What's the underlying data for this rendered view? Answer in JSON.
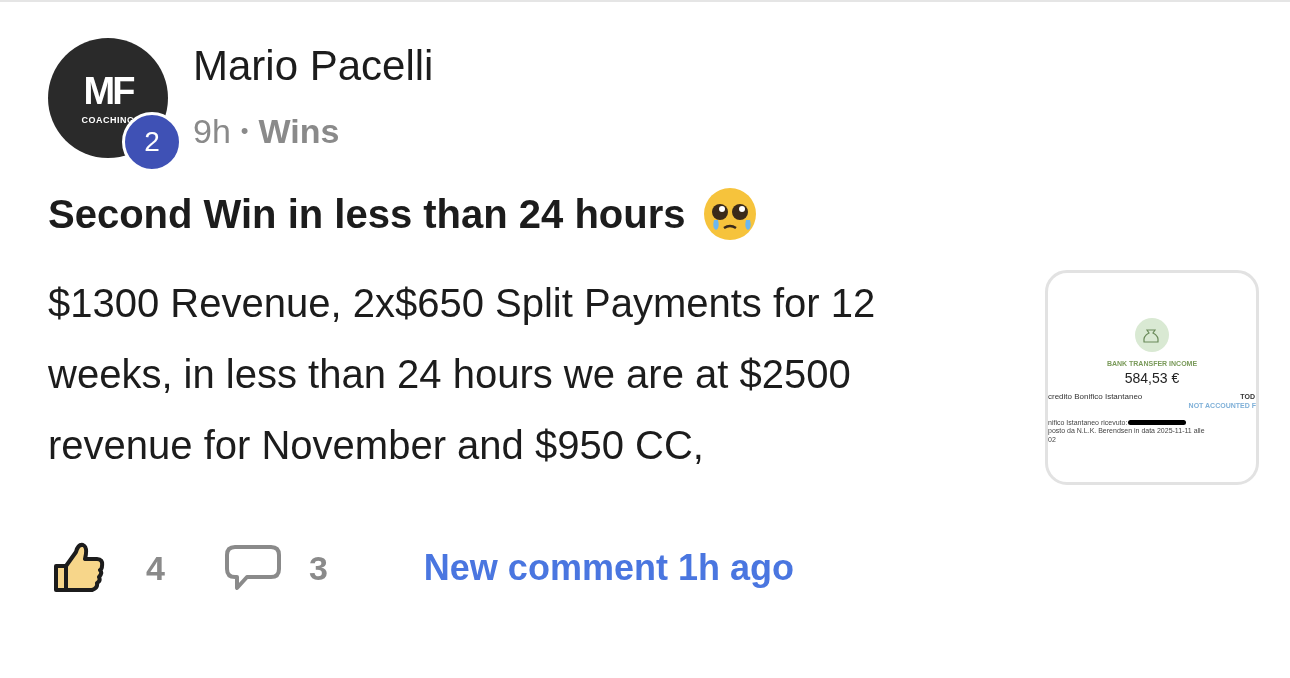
{
  "post": {
    "author": "Mario Pacelli",
    "avatar_logo": {
      "mark": "MF",
      "tagline": "COACHING"
    },
    "level_badge": "2",
    "time": "9h",
    "separator": "•",
    "category": "Wins",
    "title": "Second Win in less than 24 hours",
    "body": "$1300 Revenue, 2x$650 Split Payments for 12 weeks, in less than 24 hours we are at $2500 revenue for November and $950 CC,",
    "attachment": {
      "label": "BANK TRANSFER INCOME",
      "amount": "584,53 €",
      "line_title": "credito Bonifico Istantaneo",
      "line_date": "TOD",
      "line_status": "NOT ACCOUNTED F",
      "detail_1": "nifico Istantaneo ricevuto:",
      "detail_2": "posto da N.L.K. Berendsen in data 2025-11-11 alle",
      "detail_3": "02"
    },
    "likes": {
      "count": "4",
      "liked": true
    },
    "comments": {
      "count": "3"
    },
    "new_comment": "New comment 1h ago"
  }
}
